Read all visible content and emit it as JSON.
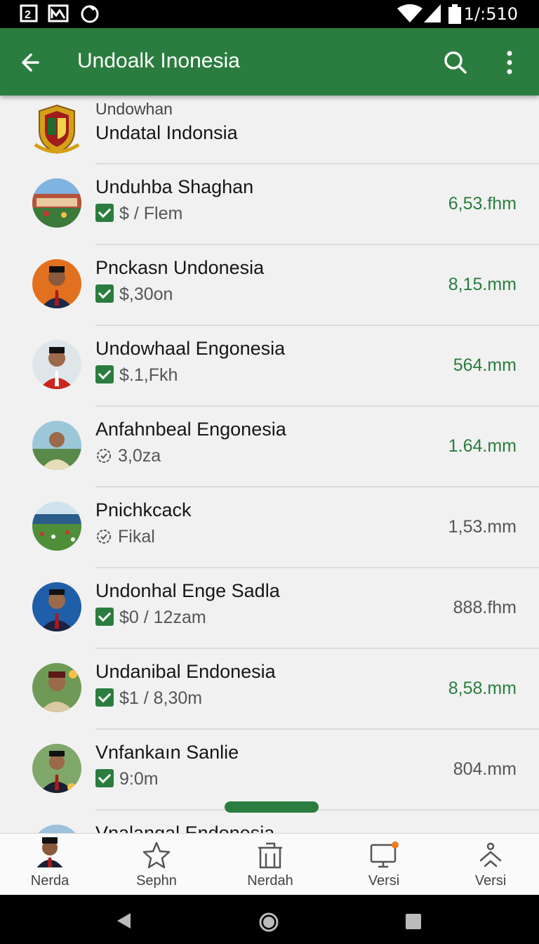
{
  "status": {
    "time": "1/:510"
  },
  "app_bar": {
    "title": "Undoalk Inonesia"
  },
  "header": {
    "small": "Undowhan",
    "title": "Undatal Indonsia"
  },
  "rows": [
    {
      "name": "Unduhba Shaghan",
      "sub": "$ / Flem",
      "amount": "6,53.fhm",
      "sub_icon": "check-icon",
      "amount_color": "green"
    },
    {
      "name": "Pnckasn Undonesia",
      "sub": "$,30on",
      "amount": "8,15.mm",
      "sub_icon": "check-icon",
      "amount_color": "green"
    },
    {
      "name": "Undowhaal Engonesia",
      "sub": "$.1,Fkh",
      "amount": "564.mm",
      "sub_icon": "check-icon",
      "amount_color": "green"
    },
    {
      "name": "Anfahnbeal Engonesia",
      "sub": "3,0za",
      "amount": "1.64.mm",
      "sub_icon": "badge-icon",
      "amount_color": "green"
    },
    {
      "name": "Pnichkcack",
      "sub": "Fikal",
      "amount": "1,53.mm",
      "sub_icon": "badge-icon",
      "amount_color": "gray"
    },
    {
      "name": "Undonhal Enge Sadla",
      "sub": "$0 / 12zam",
      "amount": "888.fhm",
      "sub_icon": "check-icon",
      "amount_color": "gray"
    },
    {
      "name": "Undanibal Endonesia",
      "sub": "$1 / 8,30m",
      "amount": "8,58.mm",
      "sub_icon": "check-icon",
      "amount_color": "green"
    },
    {
      "name": "Vnfankaın Sanlie",
      "sub": "9:0m",
      "amount": "804.mm",
      "sub_icon": "check-icon",
      "amount_color": "gray"
    },
    {
      "name": "Vnalangal Endonesia",
      "sub": "",
      "amount": "",
      "sub_icon": "",
      "amount_color": "gray"
    }
  ],
  "bottom_nav": [
    {
      "label": "Nerda",
      "icon": "person-avatar-icon"
    },
    {
      "label": "Sephn",
      "icon": "star-icon"
    },
    {
      "label": "Nerdah",
      "icon": "building-icon"
    },
    {
      "label": "Versi",
      "icon": "monitor-notification-icon"
    },
    {
      "label": "Versi",
      "icon": "person-up-icon"
    }
  ],
  "colors": {
    "primary": "#2b7d3f",
    "notification_dot": "#f07a1f"
  }
}
